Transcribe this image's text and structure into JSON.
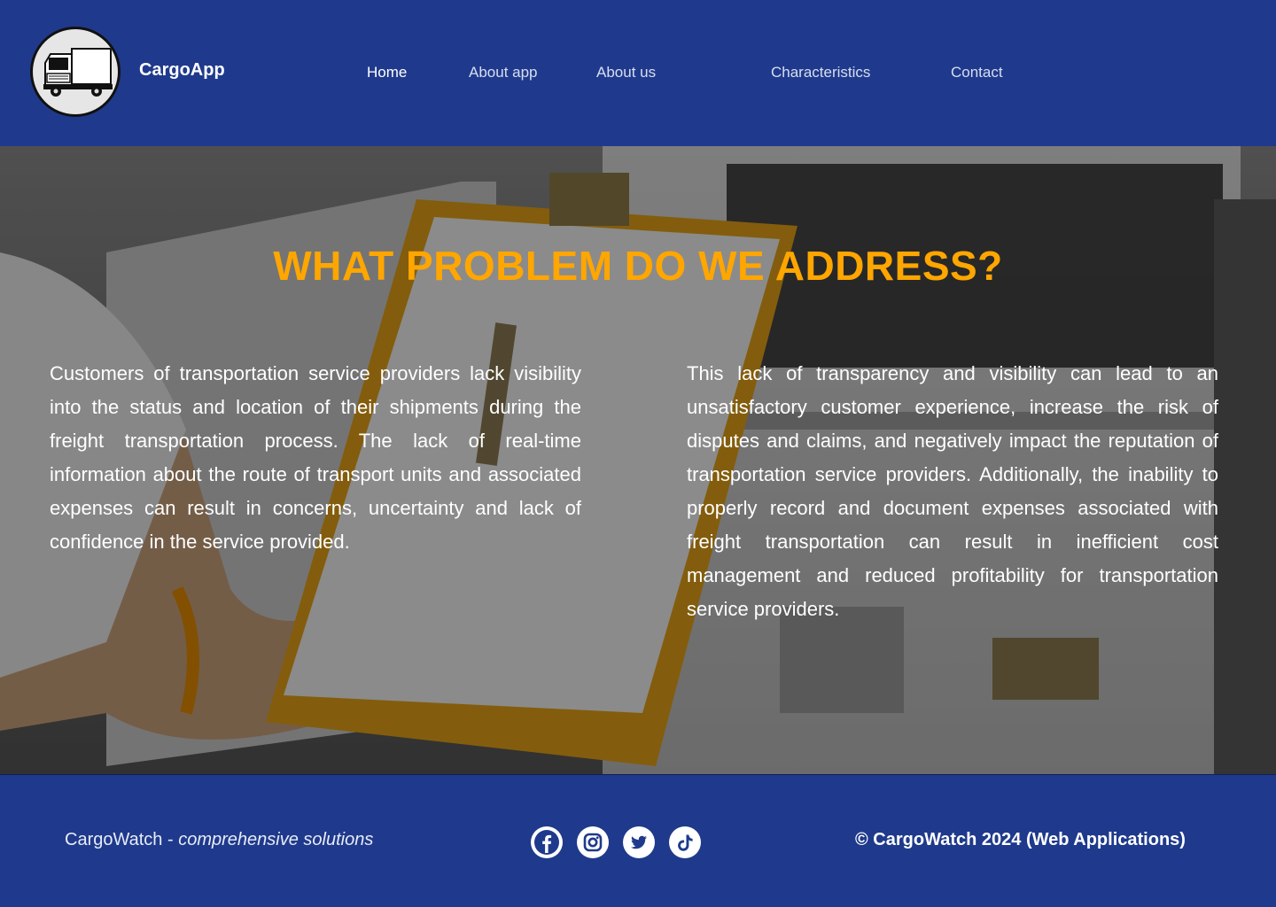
{
  "header": {
    "brand": "CargoApp",
    "logo_icon": "truck-icon",
    "nav": [
      {
        "label": "Home",
        "active": true
      },
      {
        "label": "About app",
        "active": false
      },
      {
        "label": "About us",
        "active": false
      },
      {
        "label": "Characteristics",
        "active": false
      },
      {
        "label": "Contact",
        "active": false
      }
    ]
  },
  "hero": {
    "title": "WHAT PROBLEM DO WE ADDRESS?",
    "left_text": "Customers of transportation service providers lack visibility into the status and location of their shipments during the freight transportation process. The lack of real-time information about the route of transport units and associated expenses can result in concerns, uncertainty and lack of confidence in the service provided.",
    "right_text": "This lack of transparency and visibility can lead to an unsatisfactory customer experience, increase the risk of disputes and claims, and negatively impact the reputation of transportation service providers. Additionally, the inability to properly record and document expenses associated with freight transportation can result in inefficient cost management and reduced profitability for transportation service providers."
  },
  "footer": {
    "brand_name": "CargoWatch",
    "brand_separator": " - ",
    "tagline": "comprehensive solutions",
    "social": [
      "facebook-icon",
      "instagram-icon",
      "twitter-icon",
      "tiktok-icon"
    ],
    "copyright": "© CargoWatch 2024 (Web Applications)"
  },
  "colors": {
    "primary_blue": "#1f3a8c",
    "accent_orange": "#ffa600",
    "text_white": "#ffffff"
  }
}
